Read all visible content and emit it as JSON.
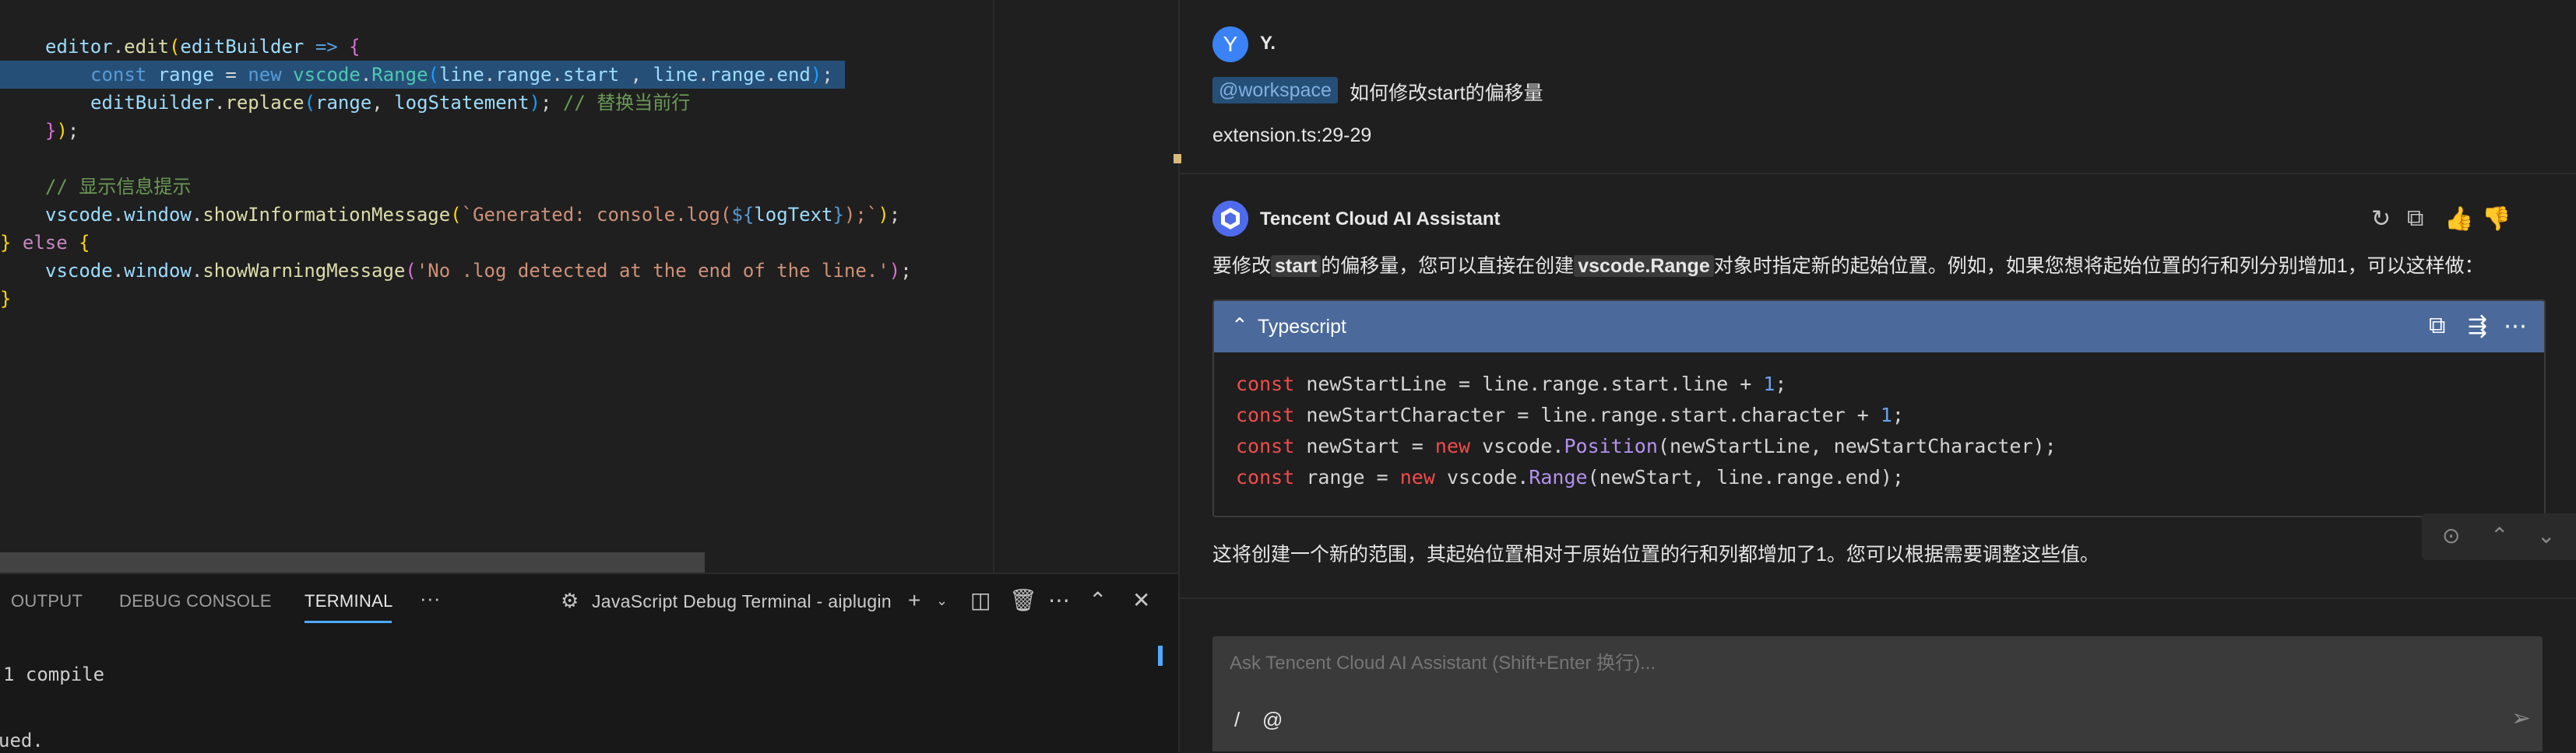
{
  "editor": {
    "lines": [
      "editor.edit(editBuilder => {",
      "const range = new vscode.Range(line.range.start , line.range.end);",
      "editBuilder.replace(range, logStatement); // 替换当前行",
      "});",
      "// 显示信息提示",
      "vscode.window.showInformationMessage(`Generated: console.log(${logText});`);",
      "} else {",
      "vscode.window.showWarningMessage('No .log detected at the end of the line.');",
      "}"
    ]
  },
  "panel": {
    "tabs": [
      "OUTPUT",
      "DEBUG CONSOLE",
      "TERMINAL"
    ],
    "more": "···",
    "terminal_name": "JavaScript Debug Terminal - aiplugin",
    "output_line1": "1 compile",
    "output_line2": "ued."
  },
  "chat": {
    "user_avatar_letter": "Y",
    "user_name": "Y.",
    "workspace_tag": "@workspace",
    "question": "如何修改start的偏移量",
    "file_ref": "extension.ts:29-29",
    "assistant_name": "Tencent Cloud AI Assistant",
    "answer_part1": "要修改",
    "answer_code1": "start",
    "answer_part2": "的偏移量，您可以直接在创建",
    "answer_code2": "vscode.Range",
    "answer_part3": "对象时指定新的起始位置。例如，如果您想将起始位置的行和列分别增加1，可以这样做：",
    "code_lang": "Typescript",
    "summary": "这将创建一个新的范围，其起始位置相对于原始位置的行和列都增加了1。您可以根据需要调整这些值。",
    "input_placeholder": "Ask Tencent Cloud AI Assistant (Shift+Enter 换行)...",
    "slash": "/",
    "at": "@"
  }
}
